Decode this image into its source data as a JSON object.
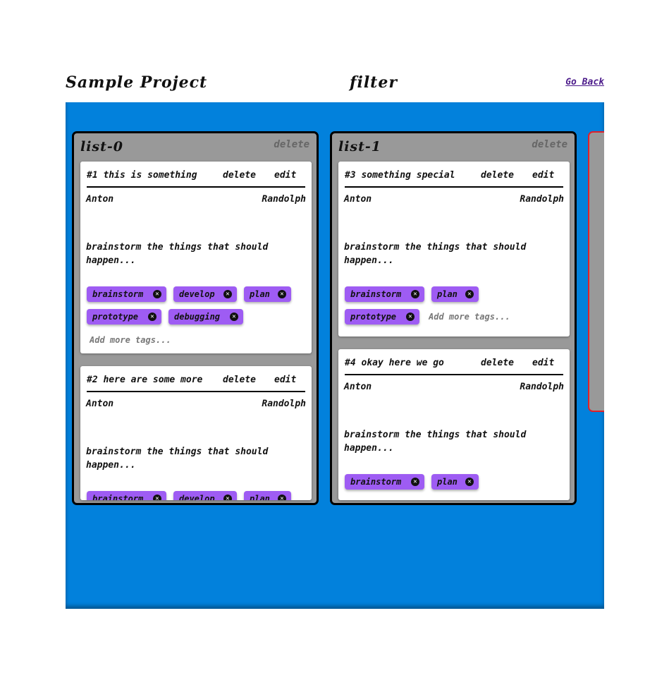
{
  "header": {
    "project_title": "Sample Project",
    "filter_title": "filter",
    "go_back": "Go Back"
  },
  "colors": {
    "board": "#0281dc",
    "list": "#999999",
    "tag": "#9e5cf3",
    "link": "#4b1a8a",
    "offscreen_list_border": "#e0202a"
  },
  "lists": [
    {
      "title": "list-0",
      "delete_label": "delete",
      "cards": [
        {
          "title": "#1 this is something",
          "delete_label": "delete",
          "edit_label": "edit",
          "author": "Anton",
          "assignee": "Randolph",
          "description": "brainstorm the things that should happen...",
          "tags": [
            "brainstorm",
            "develop",
            "plan",
            "prototype",
            "debugging"
          ],
          "tag_placeholder": "Add more tags..."
        },
        {
          "title": "#2 here are some more",
          "delete_label": "delete",
          "edit_label": "edit",
          "author": "Anton",
          "assignee": "Randolph",
          "description": "brainstorm the things that should happen...",
          "tags": [
            "brainstorm",
            "develop",
            "plan"
          ]
        }
      ]
    },
    {
      "title": "list-1",
      "delete_label": "delete",
      "cards": [
        {
          "title": "#3 something special",
          "delete_label": "delete",
          "edit_label": "edit",
          "author": "Anton",
          "assignee": "Randolph",
          "description": "brainstorm the things that should happen...",
          "tags": [
            "brainstorm",
            "plan",
            "prototype"
          ],
          "tag_placeholder": "Add more tags..."
        },
        {
          "title": "#4 okay here we go",
          "delete_label": "delete",
          "edit_label": "edit",
          "author": "Anton",
          "assignee": "Randolph",
          "description": "brainstorm the things that should happen...",
          "tags": [
            "brainstorm",
            "plan"
          ]
        }
      ]
    }
  ],
  "icons": {
    "tag_remove": "close-circle-icon"
  }
}
